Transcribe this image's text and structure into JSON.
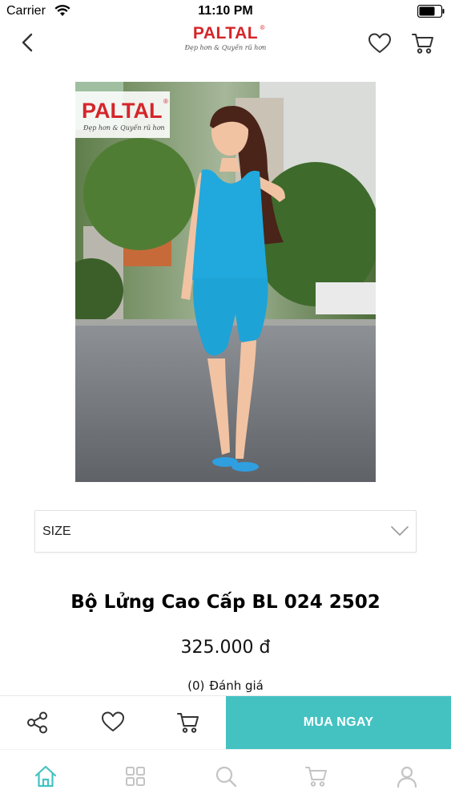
{
  "status_bar": {
    "carrier": "Carrier",
    "time": "11:10 PM"
  },
  "header": {
    "logo_text": "PALTAL",
    "logo_reg": "®",
    "logo_tagline": "Đẹp hơn & Quyến rũ hơn"
  },
  "product_image": {
    "logo_text": "PALTAL",
    "logo_reg": "®",
    "logo_tagline": "Đẹp hơn & Quyến rũ hơn"
  },
  "size_select": {
    "label": "SIZE"
  },
  "product": {
    "title": "Bộ Lửng Cao Cấp BL 024 2502",
    "price": "325.000 đ",
    "rating_count": "(0)",
    "rating_label": "Đánh giá"
  },
  "action_bar": {
    "buy_now": "MUA NGAY"
  },
  "tab_bar": {
    "items": [
      "home",
      "categories",
      "search",
      "cart",
      "account"
    ],
    "active": "home"
  },
  "colors": {
    "brand_red": "#d5262b",
    "accent_teal": "#44c2c2",
    "icon_gray": "#c4c4c4",
    "icon_dark": "#333333"
  },
  "icons": [
    "back-icon",
    "heart-icon",
    "cart-icon",
    "share-icon",
    "chevron-down-icon",
    "home-icon",
    "grid-icon",
    "search-icon",
    "user-icon",
    "wifi-icon",
    "battery-icon"
  ]
}
